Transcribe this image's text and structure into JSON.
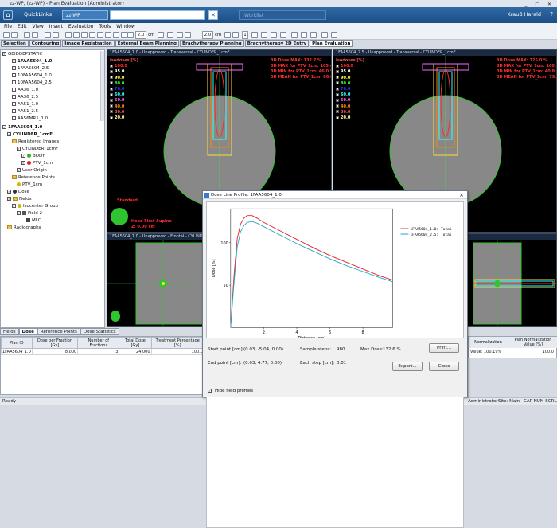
{
  "window": {
    "title": "zz-WP, (zz-WP) - Plan Evaluation (Administrator)"
  },
  "header": {
    "quicklinks": "QuickLinks",
    "patient_tab": "zz-WP",
    "worklist": "Worklist",
    "user": "Krauß Harald"
  },
  "menu": [
    "File",
    "Edit",
    "View",
    "Insert",
    "Evaluation",
    "Tools",
    "Window"
  ],
  "toolbar": {
    "zoom1": "2.0",
    "unit1": "cm",
    "zoom2": "2.0",
    "unit2": "cm",
    "field": "1"
  },
  "ptabs": [
    "Selection",
    "Contouring",
    "Image Registration",
    "External Beam Planning",
    "Brachytherapy Planning",
    "Brachytherapy 2D Entry",
    "Plan Evaluation"
  ],
  "tree_top": {
    "root": "GBIDDEPSTATIC",
    "items": [
      "1FAA5604_1.0",
      "1FAA5604_2.5",
      "10FAA5604_1.0",
      "10FAA5604_2.5",
      "AA36_1.0",
      "AA36_2.5",
      "AA51_1.0",
      "AA51_2.5",
      "AA56MR1_1.0"
    ]
  },
  "tree_bottom": {
    "plan": "1FAA5604_1.0",
    "phantom": "CYLINDER_1cmF",
    "registered": "Registered Images",
    "img": "CYLINDER_1cmF",
    "body": "BODY",
    "ptv": "PTV_1cm",
    "origin": "User Origin",
    "refpoints": "Reference Points",
    "ptv_ref": "PTV_1cm",
    "dose": "Dose",
    "fields": "Fields",
    "isocenter": "Isocenter Group I",
    "field2": "Field 2",
    "mlc": "MLC",
    "radiographs": "Radiographs"
  },
  "views": {
    "tl_header": "1FAA5604_1.0 - Unapproved - Transversal - CYLINDER_1cmF",
    "tr_header": "1FAA5604_2.5 - Unapproved - Transversal - CYLINDER_1cmF",
    "bl_header": "1FAA5604_1.0 - Unapproved - Frontal - CYLINDER_1cmF",
    "br_header": "1FAA5604_2.5 - Unapproved - Sagittal - CYLINDER_1cmF",
    "iso_title": "Isodoses [%]",
    "isodoses": [
      {
        "v": "100.0",
        "c": "#ff2a2a"
      },
      {
        "v": "95.0",
        "c": "#ffffff"
      },
      {
        "v": "90.0",
        "c": "#ffff33"
      },
      {
        "v": "80.0",
        "c": "#33ff33"
      },
      {
        "v": "70.0",
        "c": "#3333ff"
      },
      {
        "v": "60.0",
        "c": "#33ffff"
      },
      {
        "v": "50.0",
        "c": "#ff66ff"
      },
      {
        "v": "40.0",
        "c": "#ff8800"
      },
      {
        "v": "30.0",
        "c": "#ff5555"
      },
      {
        "v": "20.0",
        "c": "#ffff99"
      }
    ],
    "tl_dose": [
      "3D Dose MAX: 132.7 %",
      "3D MAX for PTV_1cm: 105.4 %",
      "3D MIN for PTV_1cm: 46.0 %",
      "3D MEAN for PTV_1cm: 86.8 %"
    ],
    "tr_dose": [
      "3D Dose MAX: 125.0 %",
      "3D MAX for PTV_1cm: 100.0 %",
      "3D MIN for PTV_1cm: 40.8 %",
      "3D MEAN for PTV_1cm: 79.7 %"
    ],
    "standard": "Standard",
    "headfirst": "Head First-Supine",
    "z": "Z: 0.00 cm"
  },
  "bottom_tabs": [
    "Fields",
    "Dose",
    "Reference Points",
    "Dose Statistics"
  ],
  "dose_table": {
    "headers": [
      "Plan ID",
      "Dose per Fraction [Gy]",
      "Number of Fractions",
      "Total Dose [Gy]",
      "Treatment Percentage [%]"
    ],
    "row": [
      "1FAA5604_1.0",
      "8.000",
      "3",
      "24.000",
      "100.0"
    ]
  },
  "right_table": {
    "h1": "Normalization",
    "h2": "Plan Normalization Value [%]",
    "c1": "Value: 100.19%",
    "c2": "100.0"
  },
  "dialog": {
    "title": "Dose Line Profile: 1FAA5604_1.0",
    "close": "×",
    "start_label": "Start point [cm]:",
    "start_val": "(0.03, -5.04, 0.00)",
    "end_label": "End point [cm]:",
    "end_val": "(0.03, 4.77, 0.00)",
    "samples_label": "Sample steps:",
    "samples_val": "980",
    "step_label": "Each step [cm]:",
    "step_val": "0.01",
    "maxdose_label": "Max Dose:",
    "maxdose_val": "132.6 %",
    "print": "Print...",
    "export": "Export...",
    "close_btn": "Close",
    "hide": "Hide field profiles"
  },
  "status": {
    "left": "Ready",
    "user": "Administrator",
    "site": "Site: Main",
    "flags": "CAP NUM SCRL"
  },
  "chart_data": {
    "type": "line",
    "xlabel": "Distance [cm]",
    "ylabel": "Dose [%]",
    "xlim": [
      0,
      9.8
    ],
    "ylim": [
      0,
      140
    ],
    "xticks": [
      2,
      4,
      6,
      8
    ],
    "yticks": [
      50,
      100
    ],
    "series": [
      {
        "name": "1FAA5604_1.0: Total",
        "color": "#e02020",
        "x": [
          0,
          0.2,
          0.4,
          0.6,
          0.8,
          1.0,
          1.3,
          1.6,
          2,
          3,
          4,
          5,
          6,
          7,
          8,
          9,
          9.8
        ],
        "y": [
          0,
          60,
          105,
          122,
          129,
          132,
          132,
          129,
          124,
          114,
          104,
          94,
          85,
          77,
          69,
          61,
          56
        ]
      },
      {
        "name": "1FAA5604_2.5: Total",
        "color": "#22a6c8",
        "x": [
          0,
          0.2,
          0.4,
          0.6,
          0.8,
          1.0,
          1.3,
          1.6,
          2,
          3,
          4,
          5,
          6,
          7,
          8,
          9,
          9.8
        ],
        "y": [
          0,
          52,
          95,
          113,
          120,
          124,
          125,
          123,
          119,
          109,
          99,
          90,
          81,
          73,
          66,
          59,
          54
        ]
      }
    ]
  }
}
